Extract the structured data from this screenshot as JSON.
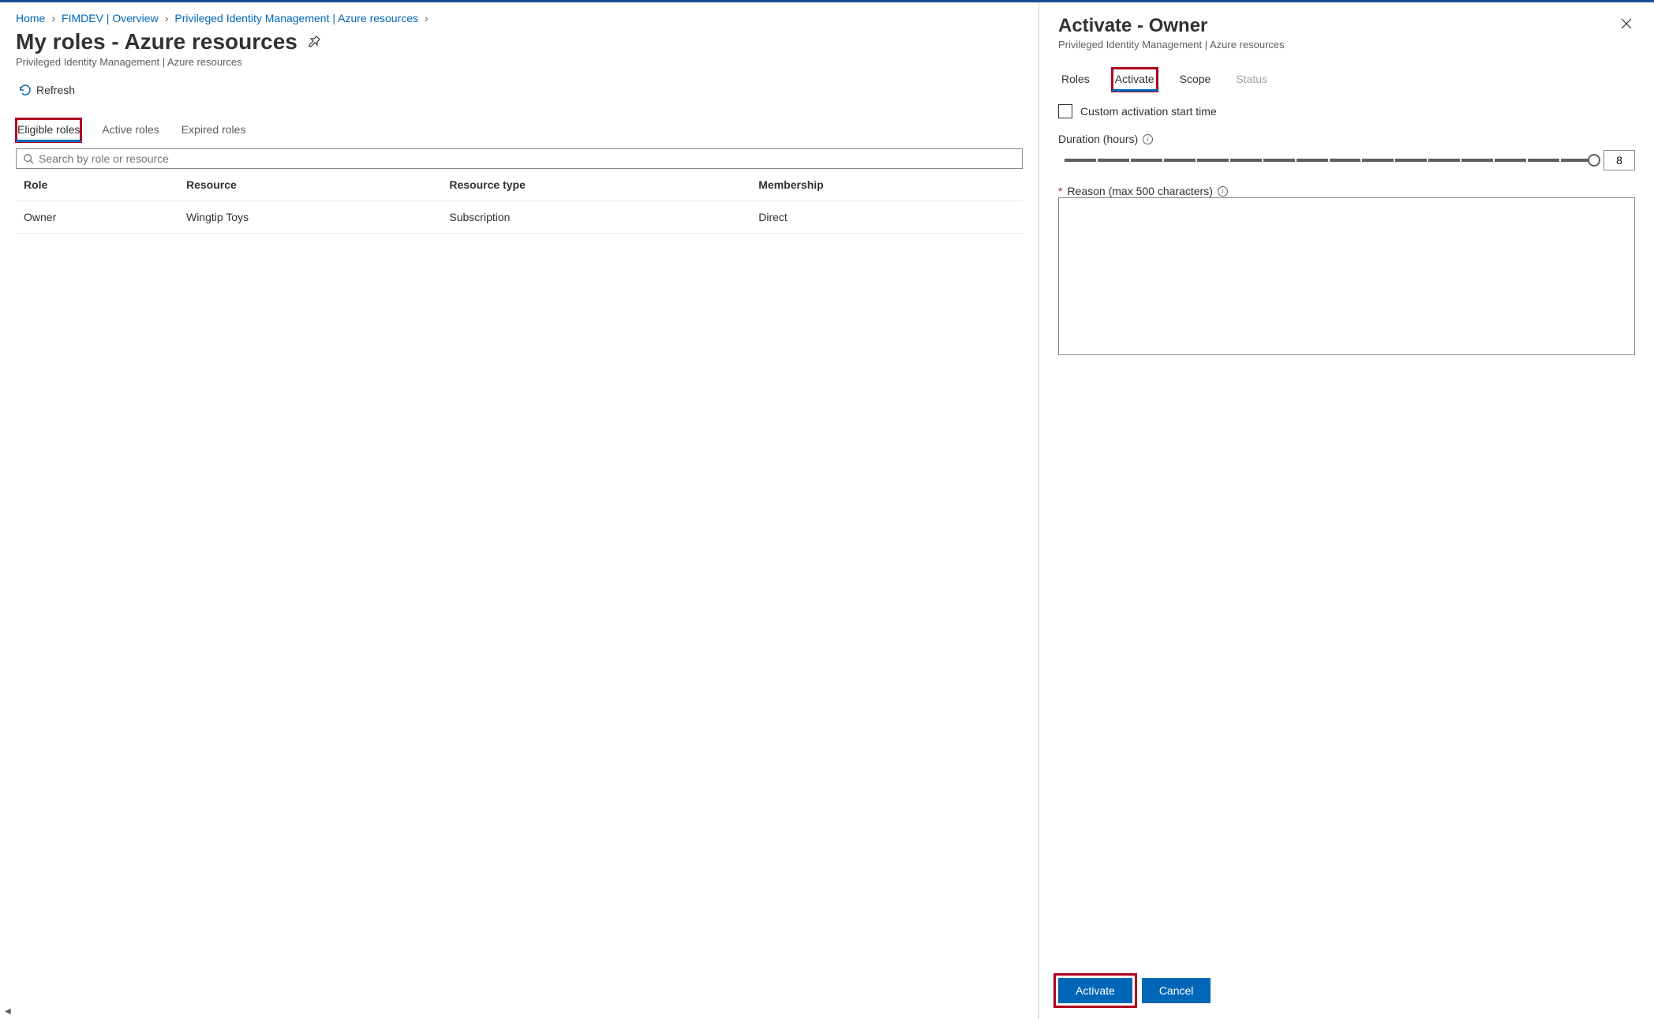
{
  "breadcrumbs": {
    "items": [
      {
        "label": "Home"
      },
      {
        "label": "FIMDEV | Overview"
      },
      {
        "label": "Privileged Identity Management | Azure resources"
      }
    ]
  },
  "page": {
    "title": "My roles - Azure resources",
    "subtitle": "Privileged Identity Management | Azure resources"
  },
  "toolbar": {
    "refresh_label": "Refresh"
  },
  "main_tabs": {
    "items": [
      {
        "label": "Eligible roles",
        "active": true
      },
      {
        "label": "Active roles",
        "active": false
      },
      {
        "label": "Expired roles",
        "active": false
      }
    ]
  },
  "search": {
    "placeholder": "Search by role or resource"
  },
  "table": {
    "headers": {
      "role": "Role",
      "resource": "Resource",
      "resource_type": "Resource type",
      "membership": "Membership"
    },
    "rows": [
      {
        "role": "Owner",
        "resource": "Wingtip Toys",
        "resource_type": "Subscription",
        "membership": "Direct"
      }
    ]
  },
  "panel": {
    "title": "Activate - Owner",
    "subtitle": "Privileged Identity Management | Azure resources",
    "tabs": {
      "roles": "Roles",
      "activate": "Activate",
      "scope": "Scope",
      "status": "Status"
    },
    "custom_start_label": "Custom activation start time",
    "duration_label": "Duration (hours)",
    "duration_value": "8",
    "reason_label": "Reason (max 500 characters)",
    "activate_button": "Activate",
    "cancel_button": "Cancel"
  }
}
